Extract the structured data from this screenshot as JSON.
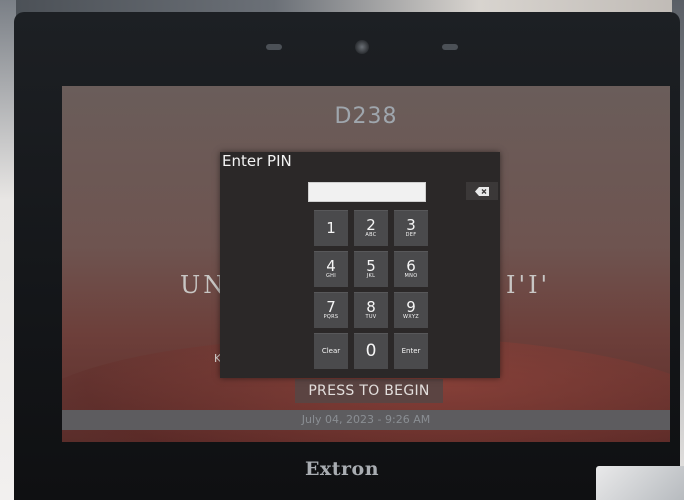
{
  "room": {
    "name": "D238"
  },
  "background": {
    "title_left": "UN",
    "title_right": "I'I'",
    "subtitle": "K"
  },
  "pin_dialog": {
    "title": "Enter PIN",
    "field_value": "",
    "keys": [
      {
        "num": "1",
        "letters": ""
      },
      {
        "num": "2",
        "letters": "ABC"
      },
      {
        "num": "3",
        "letters": "DEF"
      },
      {
        "num": "4",
        "letters": "GHI"
      },
      {
        "num": "5",
        "letters": "JKL"
      },
      {
        "num": "6",
        "letters": "MNO"
      },
      {
        "num": "7",
        "letters": "PQRS"
      },
      {
        "num": "8",
        "letters": "TUV"
      },
      {
        "num": "9",
        "letters": "WXYZ"
      }
    ],
    "clear_label": "Clear",
    "zero_label": "0",
    "enter_label": "Enter",
    "backspace_icon": "backspace-icon"
  },
  "press_to_begin": "PRESS TO BEGIN",
  "datetime": "July 04, 2023 - 9:26 AM",
  "brand": "Extron"
}
